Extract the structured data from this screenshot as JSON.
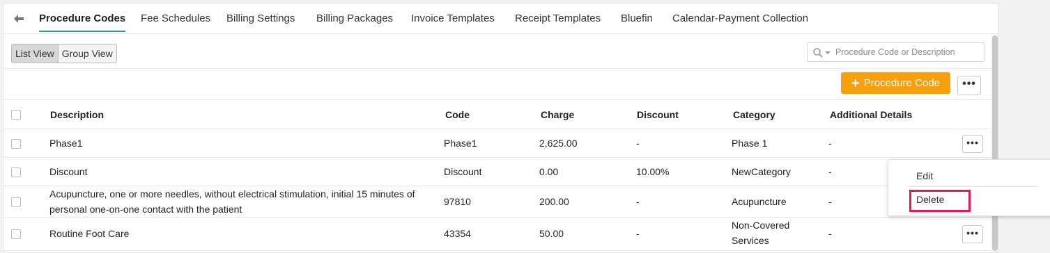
{
  "tabs": [
    {
      "label": "Procedure Codes",
      "active": true
    },
    {
      "label": "Fee Schedules"
    },
    {
      "label": "Billing Settings"
    },
    {
      "label": "Billing Packages"
    },
    {
      "label": "Invoice Templates"
    },
    {
      "label": "Receipt Templates"
    },
    {
      "label": "Bluefin"
    },
    {
      "label": "Calendar-Payment Collection"
    }
  ],
  "view_toggle": {
    "list": "List View",
    "group": "Group View",
    "selected": "List View"
  },
  "search": {
    "placeholder": "Procedure Code or Description"
  },
  "actions": {
    "add_label": "Procedure Code",
    "more_label": "•••"
  },
  "table": {
    "headers": {
      "description": "Description",
      "code": "Code",
      "charge": "Charge",
      "discount": "Discount",
      "category": "Category",
      "details": "Additional Details"
    },
    "rows": [
      {
        "description": "Phase1",
        "code": "Phase1",
        "charge": "2,625.00",
        "discount": "-",
        "category": "Phase 1",
        "details": "-"
      },
      {
        "description": "Discount",
        "code": "Discount",
        "charge": "0.00",
        "discount": "10.00%",
        "category": "NewCategory",
        "details": "-"
      },
      {
        "description": "Acupuncture, one or more needles, without electrical stimulation, initial 15 minutes of personal one-on-one contact with the patient",
        "code": "97810",
        "charge": "200.00",
        "discount": "-",
        "category": "Acupuncture",
        "details": "-"
      },
      {
        "description": "Routine Foot Care",
        "code": "43354",
        "charge": "50.00",
        "discount": "-",
        "category": "Non-Covered Services",
        "details": "-"
      }
    ]
  },
  "row_menu": {
    "edit": "Edit",
    "delete": "Delete"
  },
  "colors": {
    "accent": "#f5a00f",
    "active_tab_underline": "#2aa198",
    "highlight": "#e3195a"
  }
}
